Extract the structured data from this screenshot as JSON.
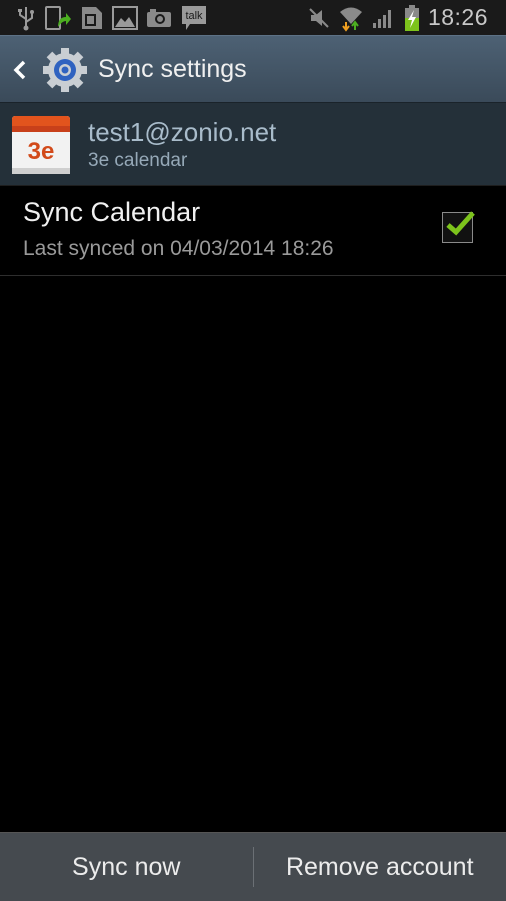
{
  "statusbar": {
    "left_icons": [
      "usb-icon",
      "phone-transfer-icon",
      "sd-card-icon",
      "gallery-icon",
      "camera-icon",
      "talk-icon"
    ],
    "talk_label": "talk",
    "right_icons": [
      "mute-icon",
      "wifi-icon",
      "signal-icon",
      "battery-charging-icon"
    ],
    "time": "18:26"
  },
  "actionbar": {
    "title": "Sync settings"
  },
  "account": {
    "icon_label": "3e",
    "email": "test1@zonio.net",
    "type": "3e calendar"
  },
  "sync_item": {
    "title": "Sync Calendar",
    "subtitle": "Last synced on 04/03/2014 18:26",
    "checked": true
  },
  "bottombar": {
    "sync_now": "Sync now",
    "remove_account": "Remove account"
  },
  "colors": {
    "check_green": "#7dc31c",
    "actionbar": "#45586a",
    "calendar_red": "#e2541d"
  }
}
